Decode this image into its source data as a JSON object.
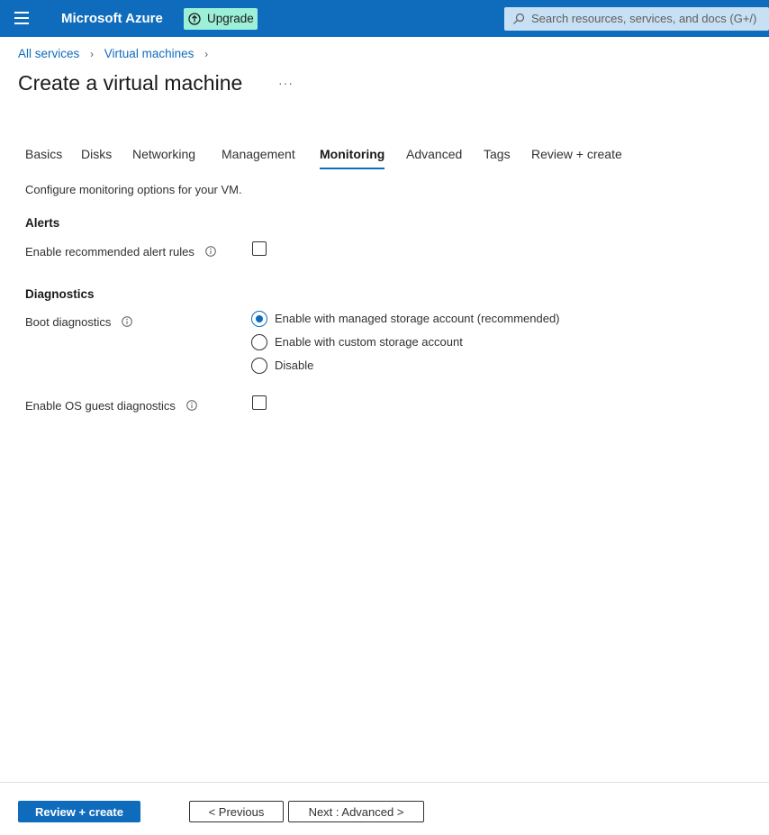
{
  "topbar": {
    "brand": "Microsoft Azure",
    "upgrade_label": "Upgrade",
    "search_placeholder": "Search resources, services, and docs (G+/)",
    "accent_color": "#0f6cbd",
    "upgrade_color": "#9cf0d8"
  },
  "breadcrumb": [
    "All services",
    "Virtual machines"
  ],
  "page": {
    "title": "Create a virtual machine",
    "more_label": "···"
  },
  "tabs": [
    {
      "label": "Basics",
      "active": false
    },
    {
      "label": "Disks",
      "active": false
    },
    {
      "label": "Networking",
      "active": false
    },
    {
      "label": "Management",
      "active": false
    },
    {
      "label": "Monitoring",
      "active": true
    },
    {
      "label": "Advanced",
      "active": false
    },
    {
      "label": "Tags",
      "active": false
    },
    {
      "label": "Review + create",
      "active": false
    }
  ],
  "monitoring": {
    "description": "Configure monitoring options for your VM.",
    "alerts": {
      "heading": "Alerts",
      "enable_alert_rules_label": "Enable recommended alert rules",
      "enable_alert_rules_checked": false
    },
    "diagnostics": {
      "heading": "Diagnostics",
      "boot_label": "Boot diagnostics",
      "boot_options": [
        {
          "label": "Enable with managed storage account (recommended)",
          "selected": true
        },
        {
          "label": "Enable with custom storage account",
          "selected": false
        },
        {
          "label": "Disable",
          "selected": false
        }
      ],
      "os_guest_label": "Enable OS guest diagnostics",
      "os_guest_checked": false
    }
  },
  "footer": {
    "review_create": "Review + create",
    "previous": "< Previous",
    "next": "Next : Advanced >"
  }
}
